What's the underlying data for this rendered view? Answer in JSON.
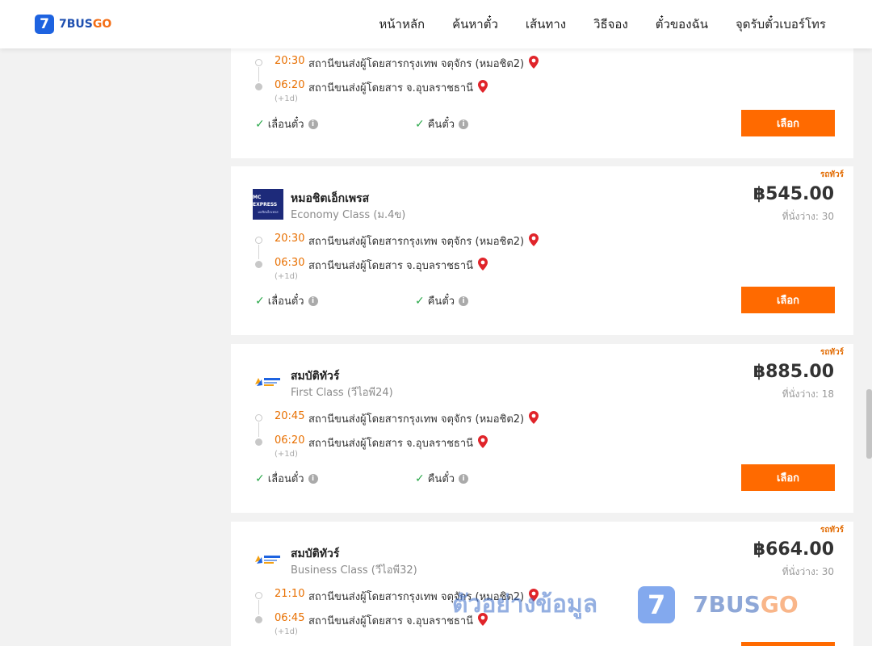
{
  "brand": {
    "logo_mark": "7",
    "name_part1": "7BUS",
    "name_part2": "GO",
    "accent": "#ff6a00",
    "primary": "#1e63e0"
  },
  "nav": [
    "หน้าหลัก",
    "ค้นหาตั๋ว",
    "เส้นทาง",
    "วิธีจอง",
    "ตั๋วของฉัน",
    "จุดรับตั๋วเบอร์โทร"
  ],
  "options": {
    "reschedule": "เลื่อนตั๋ว",
    "refund": "คืนตั๋ว"
  },
  "select_label": "เลือก",
  "cards": [
    {
      "departure_time": "20:30",
      "departure_station": "สถานีขนส่งผู้โดยสารกรุงเทพ จตุจักร (หมอชิต2)",
      "arrival_time": "06:20",
      "arrival_station": "สถานีขนส่งผู้โดยสาร จ.อุบลราชธานี",
      "plus_day": "(+1d)"
    },
    {
      "tag": "รถทัวร์",
      "operator": "หมอชิตเอ็กเพรส",
      "logo_text": "MC EXPRESS",
      "logo_sub": "มอชิตเอ็กเพรส",
      "class": "Economy Class (ม.4ข)",
      "price": "฿545.00",
      "seats": "ที่นั่งว่าง: 30",
      "departure_time": "20:30",
      "departure_station": "สถานีขนส่งผู้โดยสารกรุงเทพ จตุจักร (หมอชิต2)",
      "arrival_time": "06:30",
      "arrival_station": "สถานีขนส่งผู้โดยสาร จ.อุบลราชธานี",
      "plus_day": "(+1d)"
    },
    {
      "tag": "รถทัวร์",
      "operator": "สมบัติทัวร์",
      "class": "First Class (วีไอพี24)",
      "price": "฿885.00",
      "seats": "ที่นั่งว่าง: 18",
      "departure_time": "20:45",
      "departure_station": "สถานีขนส่งผู้โดยสารกรุงเทพ จตุจักร (หมอชิต2)",
      "arrival_time": "06:20",
      "arrival_station": "สถานีขนส่งผู้โดยสาร จ.อุบลราชธานี",
      "plus_day": "(+1d)"
    },
    {
      "tag": "รถทัวร์",
      "operator": "สมบัติทัวร์",
      "class": "Business Class (วีไอพี32)",
      "price": "฿664.00",
      "seats": "ที่นั่งว่าง: 30",
      "departure_time": "21:10",
      "departure_station": "สถานีขนส่งผู้โดยสารกรุงเทพ จตุจักร (หมอชิต2)",
      "arrival_time": "06:45",
      "arrival_station": "สถานีขนส่งผู้โดยสาร จ.อุบลราชธานี",
      "plus_day": "(+1d)"
    }
  ],
  "watermark": {
    "text": "ตัวอย่างข้อมูล",
    "logo_mark": "7",
    "brand_part1": "7BUS",
    "brand_part2": "GO"
  }
}
